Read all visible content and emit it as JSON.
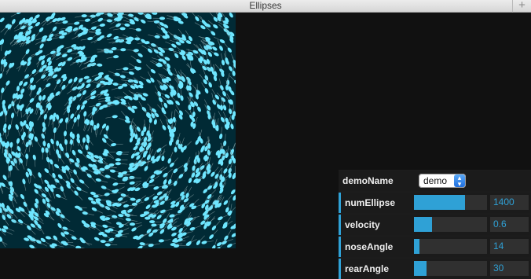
{
  "window": {
    "title": "Ellipses",
    "add_icon": "plus-icon"
  },
  "colors": {
    "canvas_bg": "#012a35",
    "ellipse": "#6ee6ff",
    "accent": "#2fa1d6"
  },
  "controls": {
    "demoName": {
      "label": "demoName",
      "value": "demo"
    },
    "numEllipse": {
      "label": "numEllipse",
      "value": "1400",
      "fraction": 0.7
    },
    "velocity": {
      "label": "velocity",
      "value": "0.6",
      "fraction": 0.25
    },
    "noseAngle": {
      "label": "noseAngle",
      "value": "14",
      "fraction": 0.08
    },
    "rearAngle": {
      "label": "rearAngle",
      "value": "30",
      "fraction": 0.17
    }
  }
}
